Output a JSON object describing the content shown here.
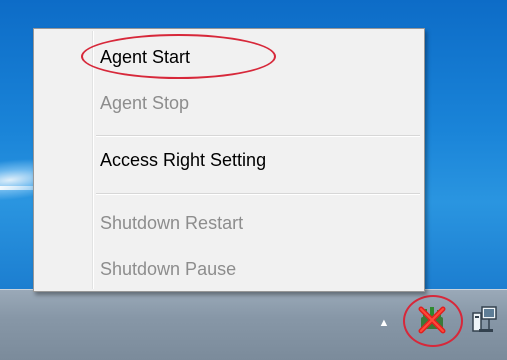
{
  "context_menu": {
    "items": [
      {
        "label": "Agent Start",
        "enabled": true
      },
      {
        "label": "Agent Stop",
        "enabled": false
      },
      {
        "label": "Access Right Setting",
        "enabled": true
      },
      {
        "label": "Shutdown Restart",
        "enabled": false
      },
      {
        "label": "Shutdown Pause",
        "enabled": false
      }
    ]
  },
  "tray": {
    "icons": [
      "show-hidden-icons-arrow",
      "agent-tray-icon",
      "network-icon"
    ]
  },
  "colors": {
    "annotation_red": "#d7283a",
    "menu_background": "#f1f1f1",
    "disabled_text": "#8d8d8d",
    "desktop_blue": "#1a84d8",
    "taskbar_gray": "#8797a7"
  }
}
